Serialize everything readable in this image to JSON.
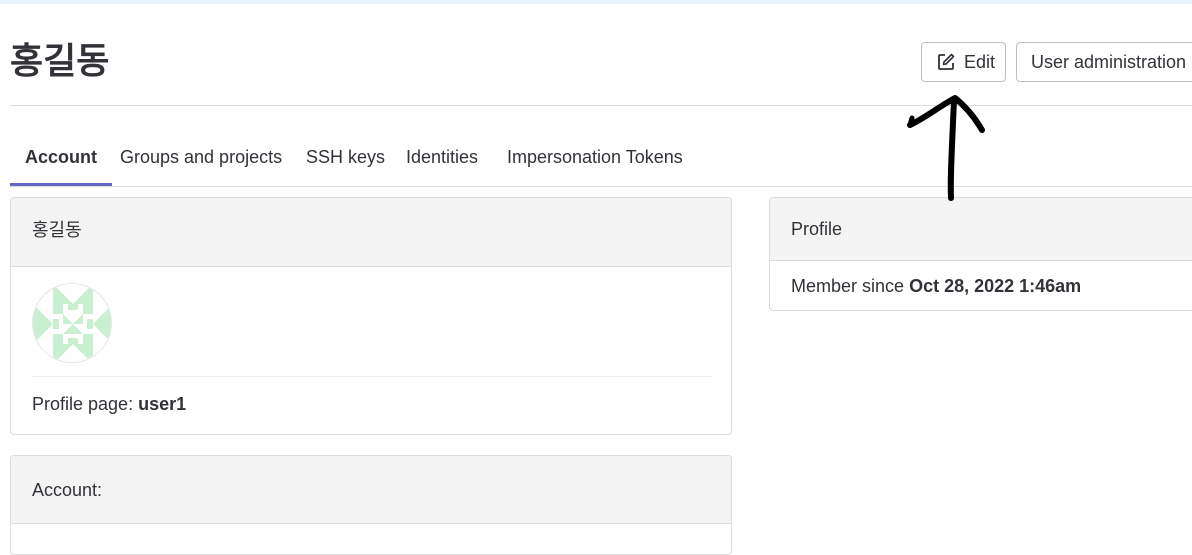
{
  "header": {
    "title": "홍길동",
    "edit_label": "Edit",
    "admin_label": "User administration"
  },
  "tabs": [
    {
      "label": "Account",
      "active": true
    },
    {
      "label": "Groups and projects"
    },
    {
      "label": "SSH keys"
    },
    {
      "label": "Identities"
    },
    {
      "label": "Impersonation Tokens"
    }
  ],
  "user_card": {
    "name": "홍길동",
    "profile_label": "Profile page:",
    "username": "user1"
  },
  "profile_card": {
    "title": "Profile",
    "member_label": "Member since",
    "member_date": "Oct 28, 2022 1:46am"
  },
  "account_card": {
    "title": "Account:"
  },
  "colors": {
    "accent": "#6666c4",
    "avatar": "#c8efd0",
    "annotation": "#000000"
  },
  "icons": {
    "edit": "pencil-square-icon",
    "dropdown": "chevron-down-icon",
    "annotation": "arrow-up-drawn"
  }
}
